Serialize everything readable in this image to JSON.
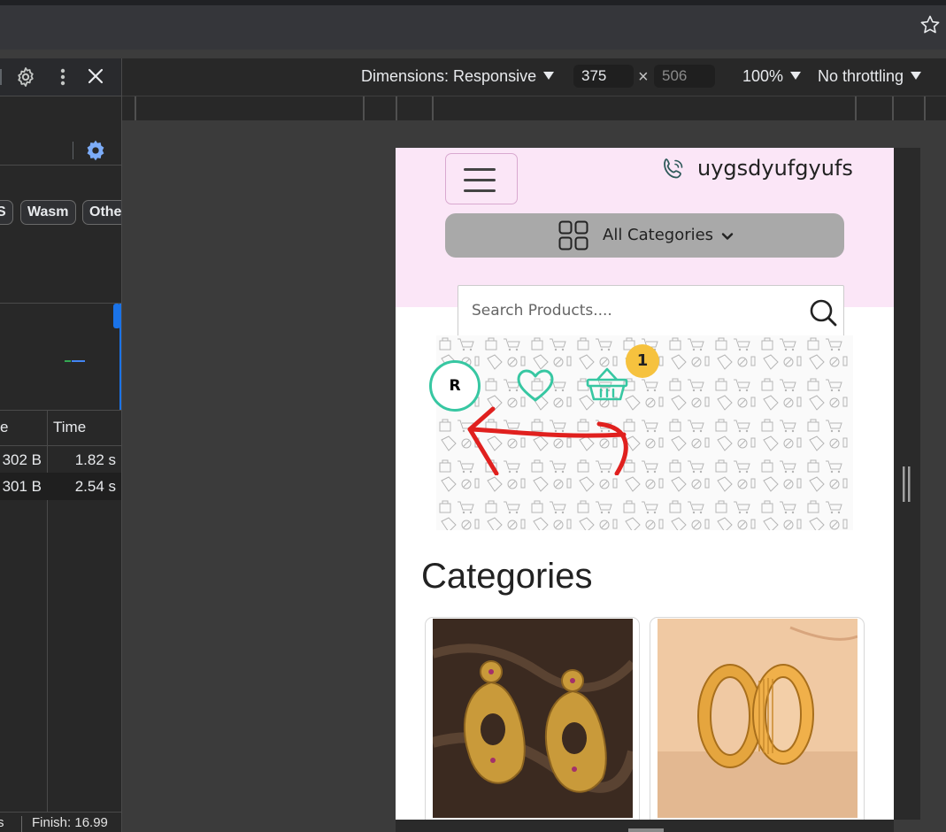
{
  "devtools": {
    "filter_chips": [
      "S",
      "Wasm",
      "Othe"
    ],
    "table": {
      "columns": [
        "e",
        "Time"
      ],
      "rows": [
        {
          "size": "302 B",
          "time": "1.82 s"
        },
        {
          "size": "301 B",
          "time": "2.54 s"
        }
      ]
    },
    "status": {
      "left": "s",
      "finish": "Finish: 16.99"
    }
  },
  "device_toolbar": {
    "dimensions_label": "Dimensions: Responsive",
    "width": "375",
    "times": "×",
    "height_placeholder": "506",
    "zoom": "100%",
    "throttling": "No throttling"
  },
  "site": {
    "phone_text": "uygsdyufgyufs",
    "categories_button": "All Categories",
    "search_placeholder": "Search Products....",
    "avatar_letter": "R",
    "cart_count": "1",
    "categories_heading": "Categories",
    "category_cards": [
      {
        "image": "gold-chandbali-earrings"
      },
      {
        "image": "gold-bangle-rings"
      }
    ]
  },
  "colors": {
    "header_pink": "#fbe6f7",
    "category_button_gray": "#a9a9a9",
    "teal_accent": "#37c7a2",
    "badge_yellow": "#f6c23e",
    "annotation_red": "#e0201e",
    "devtools_blue": "#1a73e8"
  }
}
